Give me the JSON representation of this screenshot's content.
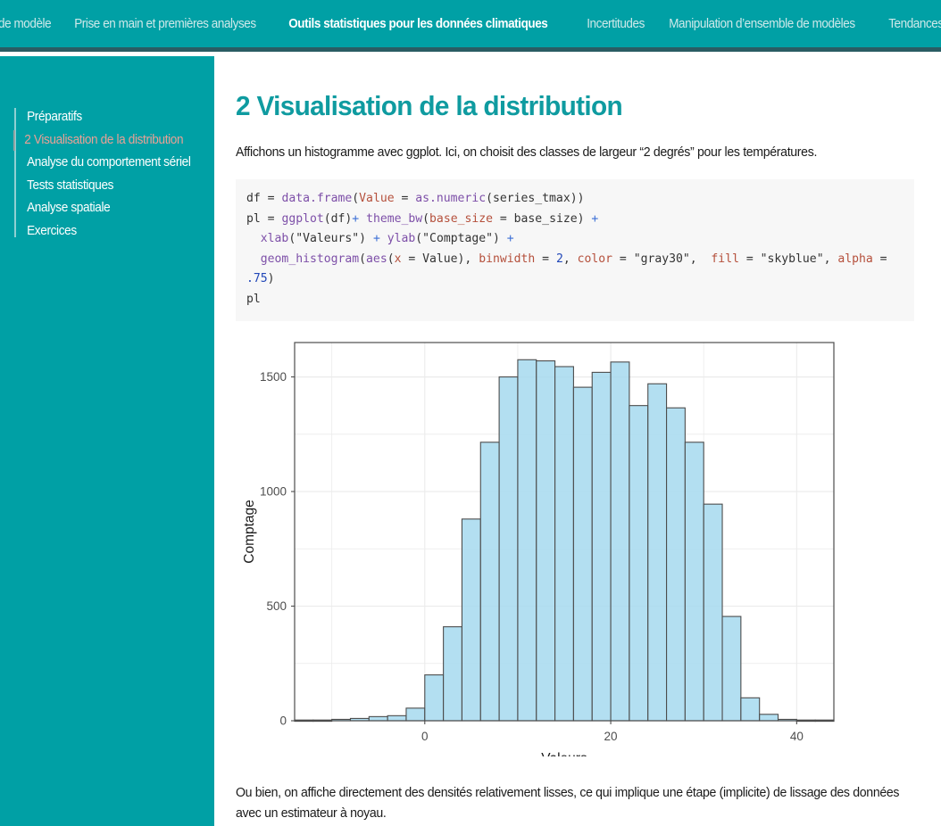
{
  "topnav": {
    "items": [
      {
        "label": "de modèle",
        "active": false
      },
      {
        "label": "Prise en main et premières analyses",
        "active": false
      },
      {
        "label": "Outils statistiques pour les données climatiques",
        "active": true
      },
      {
        "label": "Incertitudes",
        "active": false
      },
      {
        "label": "Manipulation d’ensemble de modèles",
        "active": false
      },
      {
        "label": "Tendances",
        "active": false
      }
    ]
  },
  "sidebar": {
    "items": [
      {
        "label": "Préparatifs",
        "active": false
      },
      {
        "label": "2 Visualisation de la distribution",
        "active": true
      },
      {
        "label": "Analyse du comportement sériel",
        "active": false
      },
      {
        "label": "Tests statistiques",
        "active": false
      },
      {
        "label": "Analyse spatiale",
        "active": false
      },
      {
        "label": "Exercices",
        "active": false
      }
    ]
  },
  "main": {
    "title": "2 Visualisation de la distribution",
    "intro_paragraph": "Affichons un histogramme avec ggplot. Ici, on choisit des classes de largeur “2 degrés” pour les températures.",
    "closing_paragraph": "Ou bien, on affiche directement des densités relativement lisses, ce qui implique une étape (implicite) de lissage des données avec un estimateur à noyau.",
    "code": {
      "line1": "df = data.frame(Value = as.numeric(series_tmax))",
      "line2": "pl = ggplot(df)+ theme_bw(base_size = base_size) +",
      "line3": "  xlab(\"Valeurs\") + ylab(\"Comptage\") +",
      "line4": "  geom_histogram(aes(x = Value), binwidth = 2, color = \"gray30\",  fill = \"skyblue\", alpha = .75)",
      "line5": "pl",
      "tokens": {
        "df": "df",
        "eq": "=",
        "data_frame": "data.frame",
        "Value": "Value",
        "as_numeric": "as.numeric",
        "series_tmax": "series_tmax",
        "pl": "pl",
        "ggplot": "ggplot",
        "theme_bw": "theme_bw",
        "base_size": "base_size",
        "xlab": "xlab",
        "ylab": "ylab",
        "valeurs_str": "\"Valeurs\"",
        "comptage_str": "\"Comptage\"",
        "geom_histogram": "geom_histogram",
        "aes": "aes",
        "x": "x",
        "binwidth": "binwidth",
        "two": "2",
        "color": "color",
        "gray30_str": "\"gray30\"",
        "fill": "fill",
        "skyblue_str": "\"skyblue\"",
        "alpha": "alpha",
        "p75": ".75",
        "plus": "+"
      }
    }
  },
  "colors": {
    "brand_teal": "#00a0a5",
    "nav_border": "#2a5c63",
    "heading_teal": "#0f9ba0",
    "sidebar_active": "#e8a196",
    "code_bg": "#f7f7f7",
    "bar_fill": "#a6d9ef",
    "bar_stroke": "#4d4d4d",
    "grid": "#ebebeb",
    "panel_border": "#4d4d4d"
  },
  "chart_data": {
    "type": "bar",
    "subtype": "histogram",
    "title": "",
    "xlabel": "Valeurs",
    "ylabel": "Comptage",
    "binwidth": 2,
    "xlim": [
      -14,
      44
    ],
    "ylim": [
      0,
      1650
    ],
    "xticks": [
      0,
      20,
      40
    ],
    "yticks": [
      0,
      500,
      1000,
      1500
    ],
    "xminor": [
      -10,
      10,
      30
    ],
    "yminor": [
      250,
      750,
      1250,
      1500
    ],
    "grid": true,
    "legend": "none",
    "bin_starts": [
      -14,
      -12,
      -10,
      -8,
      -6,
      -4,
      -2,
      0,
      2,
      4,
      6,
      8,
      10,
      12,
      14,
      16,
      18,
      20,
      22,
      24,
      26,
      28,
      30,
      32,
      34,
      36,
      38,
      40,
      42
    ],
    "values": [
      3,
      3,
      6,
      10,
      18,
      22,
      55,
      200,
      410,
      880,
      1215,
      1500,
      1575,
      1570,
      1545,
      1455,
      1520,
      1565,
      1375,
      1470,
      1365,
      1215,
      945,
      455,
      100,
      28,
      6,
      3,
      0
    ]
  }
}
